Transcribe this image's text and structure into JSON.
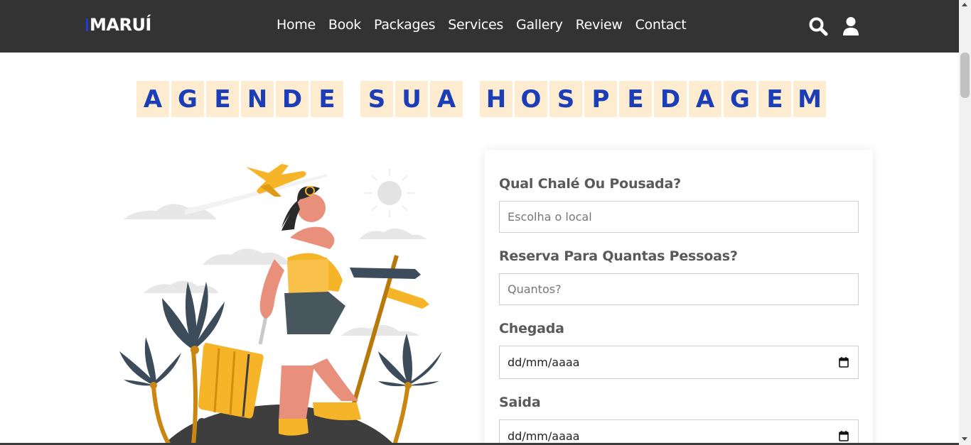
{
  "header": {
    "logo": "MARUÍ",
    "nav": [
      "Home",
      "Book",
      "Packages",
      "Services",
      "Gallery",
      "Review",
      "Contact"
    ],
    "icons": [
      "search-icon",
      "user-icon"
    ]
  },
  "heading": {
    "words": [
      "AGENDE",
      "SUA",
      "HOSPEDAGEM"
    ]
  },
  "form": {
    "place_label": "Qual Chalé Ou Pousada?",
    "place_placeholder": "Escolha o local",
    "people_label": "Reserva Para Quantas Pessoas?",
    "people_placeholder": "Quantos?",
    "arrival_label": "Chegada",
    "arrival_value": "dd/mm/aaaa",
    "departure_label": "Saida",
    "departure_value": "dd/mm/aaaa"
  },
  "colors": {
    "header_bg": "#333333",
    "accent_blue": "#1b3db8",
    "tile_bg": "#fdeccf",
    "yellow": "#f9b327"
  }
}
